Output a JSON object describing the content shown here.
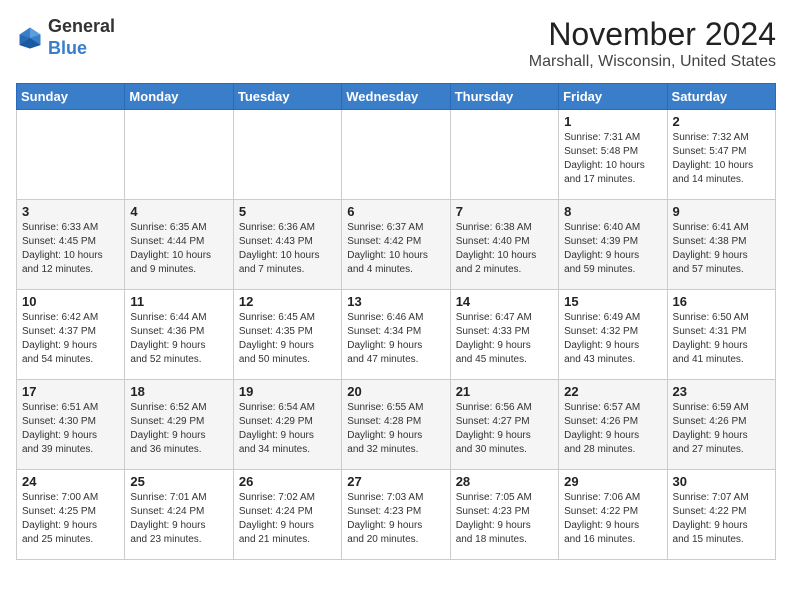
{
  "header": {
    "logo_line1": "General",
    "logo_line2": "Blue",
    "month_title": "November 2024",
    "location": "Marshall, Wisconsin, United States"
  },
  "weekdays": [
    "Sunday",
    "Monday",
    "Tuesday",
    "Wednesday",
    "Thursday",
    "Friday",
    "Saturday"
  ],
  "weeks": [
    [
      {
        "day": "",
        "info": ""
      },
      {
        "day": "",
        "info": ""
      },
      {
        "day": "",
        "info": ""
      },
      {
        "day": "",
        "info": ""
      },
      {
        "day": "",
        "info": ""
      },
      {
        "day": "1",
        "info": "Sunrise: 7:31 AM\nSunset: 5:48 PM\nDaylight: 10 hours\nand 17 minutes."
      },
      {
        "day": "2",
        "info": "Sunrise: 7:32 AM\nSunset: 5:47 PM\nDaylight: 10 hours\nand 14 minutes."
      }
    ],
    [
      {
        "day": "3",
        "info": "Sunrise: 6:33 AM\nSunset: 4:45 PM\nDaylight: 10 hours\nand 12 minutes."
      },
      {
        "day": "4",
        "info": "Sunrise: 6:35 AM\nSunset: 4:44 PM\nDaylight: 10 hours\nand 9 minutes."
      },
      {
        "day": "5",
        "info": "Sunrise: 6:36 AM\nSunset: 4:43 PM\nDaylight: 10 hours\nand 7 minutes."
      },
      {
        "day": "6",
        "info": "Sunrise: 6:37 AM\nSunset: 4:42 PM\nDaylight: 10 hours\nand 4 minutes."
      },
      {
        "day": "7",
        "info": "Sunrise: 6:38 AM\nSunset: 4:40 PM\nDaylight: 10 hours\nand 2 minutes."
      },
      {
        "day": "8",
        "info": "Sunrise: 6:40 AM\nSunset: 4:39 PM\nDaylight: 9 hours\nand 59 minutes."
      },
      {
        "day": "9",
        "info": "Sunrise: 6:41 AM\nSunset: 4:38 PM\nDaylight: 9 hours\nand 57 minutes."
      }
    ],
    [
      {
        "day": "10",
        "info": "Sunrise: 6:42 AM\nSunset: 4:37 PM\nDaylight: 9 hours\nand 54 minutes."
      },
      {
        "day": "11",
        "info": "Sunrise: 6:44 AM\nSunset: 4:36 PM\nDaylight: 9 hours\nand 52 minutes."
      },
      {
        "day": "12",
        "info": "Sunrise: 6:45 AM\nSunset: 4:35 PM\nDaylight: 9 hours\nand 50 minutes."
      },
      {
        "day": "13",
        "info": "Sunrise: 6:46 AM\nSunset: 4:34 PM\nDaylight: 9 hours\nand 47 minutes."
      },
      {
        "day": "14",
        "info": "Sunrise: 6:47 AM\nSunset: 4:33 PM\nDaylight: 9 hours\nand 45 minutes."
      },
      {
        "day": "15",
        "info": "Sunrise: 6:49 AM\nSunset: 4:32 PM\nDaylight: 9 hours\nand 43 minutes."
      },
      {
        "day": "16",
        "info": "Sunrise: 6:50 AM\nSunset: 4:31 PM\nDaylight: 9 hours\nand 41 minutes."
      }
    ],
    [
      {
        "day": "17",
        "info": "Sunrise: 6:51 AM\nSunset: 4:30 PM\nDaylight: 9 hours\nand 39 minutes."
      },
      {
        "day": "18",
        "info": "Sunrise: 6:52 AM\nSunset: 4:29 PM\nDaylight: 9 hours\nand 36 minutes."
      },
      {
        "day": "19",
        "info": "Sunrise: 6:54 AM\nSunset: 4:29 PM\nDaylight: 9 hours\nand 34 minutes."
      },
      {
        "day": "20",
        "info": "Sunrise: 6:55 AM\nSunset: 4:28 PM\nDaylight: 9 hours\nand 32 minutes."
      },
      {
        "day": "21",
        "info": "Sunrise: 6:56 AM\nSunset: 4:27 PM\nDaylight: 9 hours\nand 30 minutes."
      },
      {
        "day": "22",
        "info": "Sunrise: 6:57 AM\nSunset: 4:26 PM\nDaylight: 9 hours\nand 28 minutes."
      },
      {
        "day": "23",
        "info": "Sunrise: 6:59 AM\nSunset: 4:26 PM\nDaylight: 9 hours\nand 27 minutes."
      }
    ],
    [
      {
        "day": "24",
        "info": "Sunrise: 7:00 AM\nSunset: 4:25 PM\nDaylight: 9 hours\nand 25 minutes."
      },
      {
        "day": "25",
        "info": "Sunrise: 7:01 AM\nSunset: 4:24 PM\nDaylight: 9 hours\nand 23 minutes."
      },
      {
        "day": "26",
        "info": "Sunrise: 7:02 AM\nSunset: 4:24 PM\nDaylight: 9 hours\nand 21 minutes."
      },
      {
        "day": "27",
        "info": "Sunrise: 7:03 AM\nSunset: 4:23 PM\nDaylight: 9 hours\nand 20 minutes."
      },
      {
        "day": "28",
        "info": "Sunrise: 7:05 AM\nSunset: 4:23 PM\nDaylight: 9 hours\nand 18 minutes."
      },
      {
        "day": "29",
        "info": "Sunrise: 7:06 AM\nSunset: 4:22 PM\nDaylight: 9 hours\nand 16 minutes."
      },
      {
        "day": "30",
        "info": "Sunrise: 7:07 AM\nSunset: 4:22 PM\nDaylight: 9 hours\nand 15 minutes."
      }
    ]
  ]
}
